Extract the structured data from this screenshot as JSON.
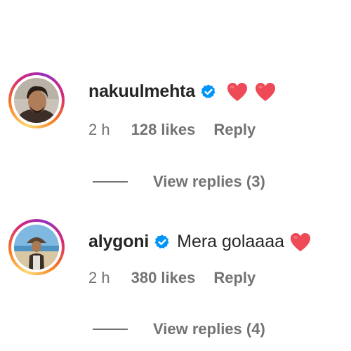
{
  "comments": [
    {
      "username": "nakuulmehta",
      "text": "",
      "hearts": 2,
      "time": "2 h",
      "likes": "128 likes",
      "reply_label": "Reply",
      "view_replies": "View replies (3)"
    },
    {
      "username": "alygoni",
      "text": "Mera golaaaa",
      "hearts": 1,
      "time": "2 h",
      "likes": "380 likes",
      "reply_label": "Reply",
      "view_replies": "View replies (4)"
    }
  ],
  "colors": {
    "verified": "#0095f6",
    "heart": "#ed4956",
    "secondary_text": "#737373",
    "primary_text": "#262626"
  },
  "icons": [
    "verified-badge-icon",
    "red-heart-emoji"
  ]
}
